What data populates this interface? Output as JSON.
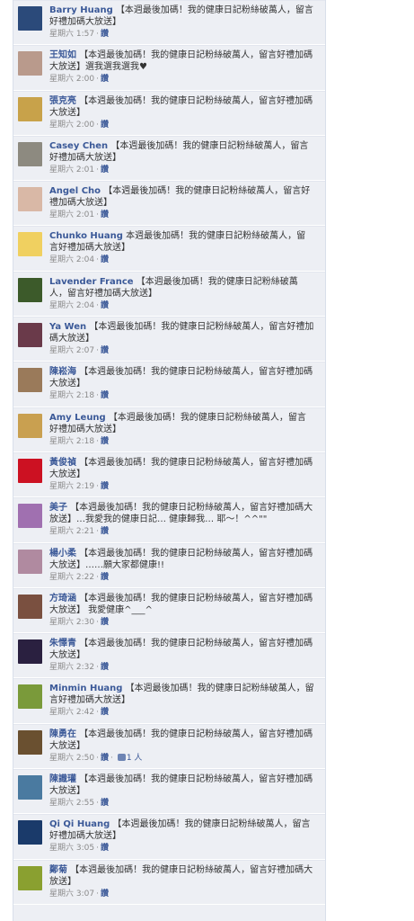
{
  "reply_label": "讚",
  "colors": {
    "link": "#3b5998",
    "bg": "#edeff4",
    "meta": "#8a8a8a"
  },
  "comments": [
    {
      "author": "Barry Huang",
      "text": "【本週最後加碼！我的健康日記粉絲破萬人，留言好禮加碼大放送】",
      "time": "星期六 1:57",
      "avatar": "#2b4a7a"
    },
    {
      "author": "王知如",
      "text": "【本週最後加碼！我的健康日記粉絲破萬人，留言好禮加碼大放送】選我選我選我♥",
      "time": "星期六 2:00",
      "avatar": "#b99a8c"
    },
    {
      "author": "張克亮",
      "text": "【本週最後加碼！我的健康日記粉絲破萬人，留言好禮加碼大放送】",
      "time": "星期六 2:00",
      "avatar": "#c8a24a"
    },
    {
      "author": "Casey Chen",
      "text": "【本週最後加碼！我的健康日記粉絲破萬人，留言好禮加碼大放送】",
      "time": "星期六 2:01",
      "avatar": "#8d8a80"
    },
    {
      "author": "Angel Cho",
      "text": "【本週最後加碼！我的健康日記粉絲破萬人，留言好禮加碼大放送】",
      "time": "星期六 2:01",
      "avatar": "#d9b8a6"
    },
    {
      "author": "Chunko Huang",
      "text": "本週最後加碼！我的健康日記粉絲破萬人，留言好禮加碼大放送】",
      "time": "星期六 2:04",
      "avatar": "#f0d060"
    },
    {
      "author": "Lavender France",
      "text": "【本週最後加碼！我的健康日記粉絲破萬人，留言好禮加碼大放送】",
      "time": "星期六 2:04",
      "avatar": "#3c5a2a"
    },
    {
      "author": "Ya Wen",
      "text": "【本週最後加碼！我的健康日記粉絲破萬人，留言好禮加碼大放送】",
      "time": "星期六 2:07",
      "avatar": "#6a3a4a"
    },
    {
      "author": "陳崧海",
      "text": "【本週最後加碼！我的健康日記粉絲破萬人，留言好禮加碼大放送】",
      "time": "星期六 2:18",
      "avatar": "#9a7a5a"
    },
    {
      "author": "Amy Leung",
      "text": "【本週最後加碼！我的健康日記粉絲破萬人，留言好禮加碼大放送】",
      "time": "星期六 2:18",
      "avatar": "#c9a050"
    },
    {
      "author": "黃俊禎",
      "text": "【本週最後加碼！我的健康日記粉絲破萬人，留言好禮加碼大放送】",
      "time": "星期六 2:19",
      "avatar": "#cc1122"
    },
    {
      "author": "美子",
      "text": "【本週最後加碼！我的健康日記粉絲破萬人，留言好禮加碼大放送】…我愛我的健康日記… 健康歸我… 耶～！^^\"\"",
      "time": "星期六 2:21",
      "avatar": "#a070b0"
    },
    {
      "author": "楊小柔",
      "text": "【本週最後加碼！我的健康日記粉絲破萬人，留言好禮加碼大放送】……願大家都健康!!",
      "time": "星期六 2:22",
      "avatar": "#b08aa0"
    },
    {
      "author": "方琦涵",
      "text": "【本週最後加碼！我的健康日記粉絲破萬人，留言好禮加碼大放送】 我愛健康^___^",
      "time": "星期六 2:30",
      "avatar": "#7a5040"
    },
    {
      "author": "朱懌青",
      "text": "【本週最後加碼！我的健康日記粉絲破萬人，留言好禮加碼大放送】",
      "time": "星期六 2:32",
      "avatar": "#2a2040"
    },
    {
      "author": "Minmin Huang",
      "text": "【本週最後加碼！我的健康日記粉絲破萬人，留言好禮加碼大放送】",
      "time": "星期六 2:42",
      "avatar": "#7a9a3a"
    },
    {
      "author": "陳勇在",
      "text": "【本週最後加碼！我的健康日記粉絲破萬人，留言好禮加碼大放送】",
      "time": "星期六 2:50",
      "avatar": "#6a5030",
      "likes": "1 人"
    },
    {
      "author": "陳識瓘",
      "text": "【本週最後加碼！我的健康日記粉絲破萬人，留言好禮加碼大放送】",
      "time": "星期六 2:55",
      "avatar": "#4a7aa0"
    },
    {
      "author": "Qi Qi Huang",
      "text": "【本週最後加碼！我的健康日記粉絲破萬人，留言好禮加碼大放送】",
      "time": "星期六 3:05",
      "avatar": "#1a3a6a"
    },
    {
      "author": "鄭菊",
      "text": "【本週最後加碼！我的健康日記粉絲破萬人，留言好禮加碼大放送】",
      "time": "星期六 3:07",
      "avatar": "#8aa030"
    }
  ]
}
